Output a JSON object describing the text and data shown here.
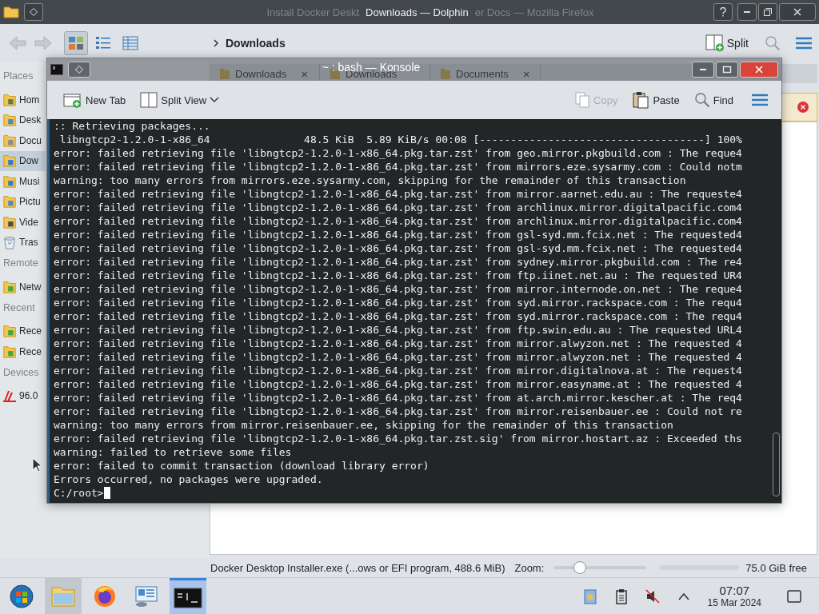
{
  "dolphin": {
    "title_behind_left": "Install Docker Deskt",
    "title": "Downloads — Dolphin",
    "title_behind_right": "er Docs — Mozilla Firefox",
    "view_modes": [
      {
        "selected": true
      },
      {
        "selected": false
      },
      {
        "selected": false
      }
    ],
    "breadcrumb": "Downloads",
    "split": "Split",
    "tabs": [
      {
        "label": "Downloads",
        "close": "×"
      },
      {
        "label": "Downloads"
      },
      {
        "label": "Documents",
        "close": "×"
      }
    ],
    "sidebar": [
      {
        "heading": "Places",
        "items": [
          {
            "label": "Hom",
            "selected": false
          },
          {
            "label": "Desk",
            "selected": false
          },
          {
            "label": "Docu",
            "selected": false
          },
          {
            "label": "Dow",
            "selected": true
          },
          {
            "label": "Musi",
            "selected": false
          },
          {
            "label": "Pictu",
            "selected": false
          },
          {
            "label": "Vide",
            "selected": false
          },
          {
            "label": "Tras",
            "selected": false
          }
        ]
      },
      {
        "heading": "Remote",
        "items": [
          {
            "label": "Netw",
            "selected": false
          }
        ]
      },
      {
        "heading": "Recent",
        "items": [
          {
            "label": "Rece",
            "selected": false
          },
          {
            "label": "Rece",
            "selected": false
          }
        ]
      },
      {
        "heading": "Devices",
        "items": [
          {
            "label": "96.0",
            "selected": false
          }
        ]
      }
    ],
    "status": {
      "file_info": "Docker Desktop Installer.exe (...ows or EFI program, 488.6 MiB)",
      "zoom_label": "Zoom:",
      "zoom": {
        "level": 0.28
      },
      "free_space": "75.0 GiB free"
    }
  },
  "konsole": {
    "title": "~ : bash — Konsole",
    "toolbar_left": [
      {
        "label": "New Tab",
        "disabled": false
      },
      {
        "label": "Split View",
        "disabled": false
      }
    ],
    "toolbar_right": [
      {
        "label": "Copy",
        "disabled": true
      },
      {
        "label": "Paste",
        "disabled": false
      },
      {
        "label": "Find",
        "disabled": false
      }
    ],
    "lines": [
      ":: Retrieving packages...",
      " libngtcp2-1.2.0-1-x86_64               48.5 KiB  5.89 KiB/s 00:08 [------------------------------------] 100%",
      "error: failed retrieving file 'libngtcp2-1.2.0-1-x86_64.pkg.tar.zst' from geo.mirror.pkgbuild.com : The reque4",
      "error: failed retrieving file 'libngtcp2-1.2.0-1-x86_64.pkg.tar.zst' from mirrors.eze.sysarmy.com : Could notm",
      "warning: too many errors from mirrors.eze.sysarmy.com, skipping for the remainder of this transaction",
      "error: failed retrieving file 'libngtcp2-1.2.0-1-x86_64.pkg.tar.zst' from mirror.aarnet.edu.au : The requeste4",
      "error: failed retrieving file 'libngtcp2-1.2.0-1-x86_64.pkg.tar.zst' from archlinux.mirror.digitalpacific.com4",
      "error: failed retrieving file 'libngtcp2-1.2.0-1-x86_64.pkg.tar.zst' from archlinux.mirror.digitalpacific.com4",
      "error: failed retrieving file 'libngtcp2-1.2.0-1-x86_64.pkg.tar.zst' from gsl-syd.mm.fcix.net : The requested4",
      "error: failed retrieving file 'libngtcp2-1.2.0-1-x86_64.pkg.tar.zst' from gsl-syd.mm.fcix.net : The requested4",
      "error: failed retrieving file 'libngtcp2-1.2.0-1-x86_64.pkg.tar.zst' from sydney.mirror.pkgbuild.com : The re4",
      "error: failed retrieving file 'libngtcp2-1.2.0-1-x86_64.pkg.tar.zst' from ftp.iinet.net.au : The requested UR4",
      "error: failed retrieving file 'libngtcp2-1.2.0-1-x86_64.pkg.tar.zst' from mirror.internode.on.net : The reque4",
      "error: failed retrieving file 'libngtcp2-1.2.0-1-x86_64.pkg.tar.zst' from syd.mirror.rackspace.com : The requ4",
      "error: failed retrieving file 'libngtcp2-1.2.0-1-x86_64.pkg.tar.zst' from syd.mirror.rackspace.com : The requ4",
      "error: failed retrieving file 'libngtcp2-1.2.0-1-x86_64.pkg.tar.zst' from ftp.swin.edu.au : The requested URL4",
      "error: failed retrieving file 'libngtcp2-1.2.0-1-x86_64.pkg.tar.zst' from mirror.alwyzon.net : The requested 4",
      "error: failed retrieving file 'libngtcp2-1.2.0-1-x86_64.pkg.tar.zst' from mirror.alwyzon.net : The requested 4",
      "error: failed retrieving file 'libngtcp2-1.2.0-1-x86_64.pkg.tar.zst' from mirror.digitalnova.at : The request4",
      "error: failed retrieving file 'libngtcp2-1.2.0-1-x86_64.pkg.tar.zst' from mirror.easyname.at : The requested 4",
      "error: failed retrieving file 'libngtcp2-1.2.0-1-x86_64.pkg.tar.zst' from at.arch.mirror.kescher.at : The req4",
      "error: failed retrieving file 'libngtcp2-1.2.0-1-x86_64.pkg.tar.zst' from mirror.reisenbauer.ee : Could not re",
      "warning: too many errors from mirror.reisenbauer.ee, skipping for the remainder of this transaction",
      "error: failed retrieving file 'libngtcp2-1.2.0-1-x86_64.pkg.tar.zst.sig' from mirror.hostart.az : Exceeded ths",
      "warning: failed to retrieve some files",
      "error: failed to commit transaction (download library error)",
      "Errors occurred, no packages were upgraded."
    ],
    "prompt": "C:/root>"
  },
  "taskbar": {
    "apps": [
      {
        "active": false,
        "hovered": false
      },
      {
        "active": false,
        "hovered": true
      },
      {
        "active": false,
        "hovered": false
      },
      {
        "active": false,
        "hovered": false
      },
      {
        "active": true,
        "hovered": false
      }
    ],
    "clock": {
      "time": "07:07",
      "date": "15 Mar 2024"
    }
  }
}
